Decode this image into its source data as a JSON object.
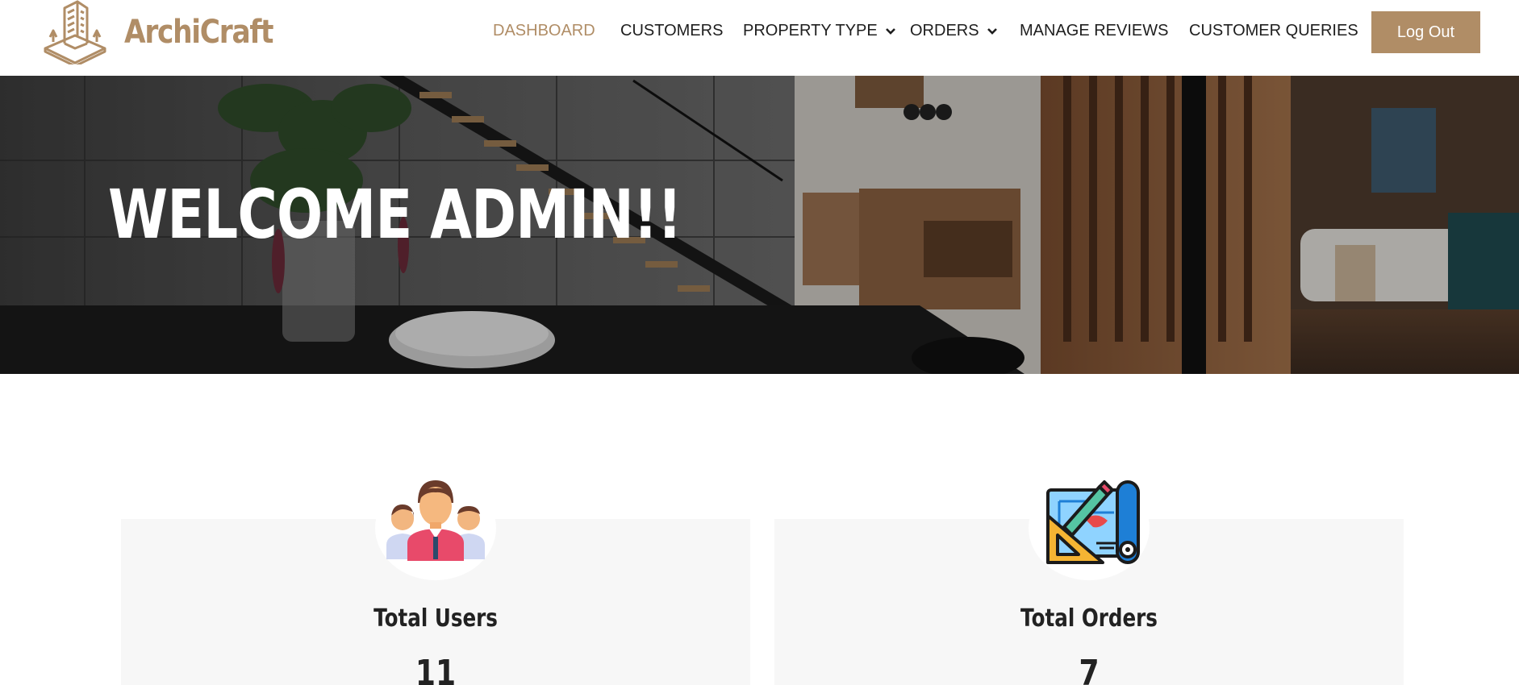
{
  "brand": {
    "name": "ArchiCraft",
    "color": "#b08d66"
  },
  "nav": {
    "items": [
      {
        "label": "DASHBOARD",
        "active": true
      },
      {
        "label": "CUSTOMERS",
        "active": false
      },
      {
        "label": "PROPERTY TYPE",
        "active": false,
        "dropdown": true
      },
      {
        "label": "ORDERS",
        "active": false,
        "dropdown": true
      },
      {
        "label": "MANAGE REVIEWS",
        "active": false
      },
      {
        "label": "CUSTOMER QUERIES",
        "active": false
      }
    ],
    "logout_label": "Log Out"
  },
  "hero": {
    "title": "WELCOME ADMIN!!"
  },
  "stats": [
    {
      "title": "Total Users",
      "value": "11",
      "icon": "users-group-icon"
    },
    {
      "title": "Total Orders",
      "value": "7",
      "icon": "blueprint-icon"
    }
  ]
}
